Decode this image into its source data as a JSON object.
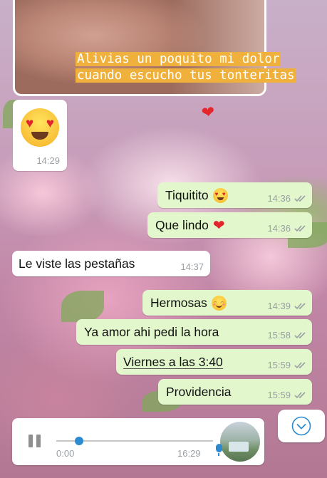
{
  "story": {
    "caption": "Alivias un poquito mi dolor cuando escucho tus tonteritas",
    "sticker": "heart"
  },
  "chat": {
    "messages": [
      {
        "side": "in",
        "emoji_only": true,
        "emoji": "heart-eyes",
        "text": "",
        "time": "14:29"
      },
      {
        "side": "out",
        "text": "Tiquitito",
        "emoji": "heart-eyes",
        "time": "14:36",
        "ticks": "double"
      },
      {
        "side": "out",
        "text": "Que lindo",
        "emoji": "red-heart",
        "time": "14:36",
        "ticks": "double"
      },
      {
        "side": "in",
        "text": "Le viste las pestañas",
        "time": "14:37"
      },
      {
        "side": "out",
        "text": "Hermosas",
        "emoji": "smiling-face",
        "time": "14:39",
        "ticks": "double"
      },
      {
        "side": "out",
        "text": "Ya amor ahi pedi la hora",
        "time": "15:58",
        "ticks": "double"
      },
      {
        "side": "out",
        "text": "Viernes a las 3:40",
        "time": "15:59",
        "ticks": "double"
      },
      {
        "side": "out",
        "text": "Providencia",
        "time": "15:59",
        "ticks": "double"
      }
    ]
  },
  "audio": {
    "state": "playing",
    "current": "0:00",
    "duration": "16:29",
    "progress": 0.1
  },
  "colors": {
    "outgoing": "#e2f7cb",
    "incoming": "#ffffff",
    "caption_bg": "#f0b13c",
    "accent": "#2b8ad0"
  }
}
